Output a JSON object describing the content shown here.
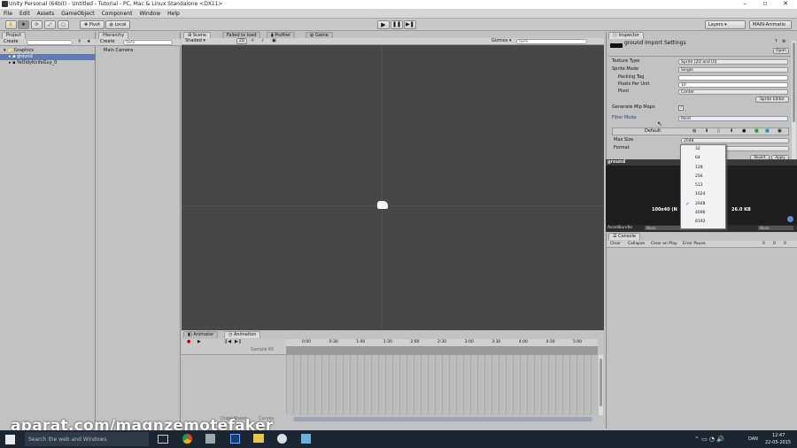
{
  "window": {
    "title": "Unity Personal (64bit) - Untitled - Tutorial - PC, Mac & Linux Standalone <DX11>"
  },
  "menu": [
    "File",
    "Edit",
    "Assets",
    "GameObject",
    "Component",
    "Window",
    "Help"
  ],
  "toolbar": {
    "pivot": "Pivot",
    "local": "Local",
    "layers": "Layers",
    "layout": "MAIN-Animatio"
  },
  "project": {
    "tab": "Project",
    "create": "Create",
    "tree": [
      {
        "label": "Graphics",
        "indent": 0
      },
      {
        "label": "ground",
        "indent": 1,
        "selected": true
      },
      {
        "label": "YeOldyKnifeGuy_0",
        "indent": 1
      }
    ]
  },
  "hierarchy": {
    "tab": "Hierarchy",
    "create": "Create",
    "search": "Q▾All",
    "items": [
      "Main Camera"
    ]
  },
  "scene": {
    "tabs": {
      "scene": "Scene",
      "failed": "Failed to load",
      "profiler": "Profiler",
      "game": "Game"
    },
    "shaded": "Shaded",
    "mode2d": "2D",
    "gizmos": "Gizmos",
    "gizmo_search": "Q▾All"
  },
  "inspector": {
    "tab": "Inspector",
    "title": "ground Import Settings",
    "open": "Open",
    "rows": [
      {
        "label": "Texture Type",
        "value": "Sprite (2D and UI)"
      },
      {
        "label": "Sprite Mode",
        "value": "Single"
      },
      {
        "label": "Packing Tag",
        "value": ""
      },
      {
        "label": "Pixels Per Unit",
        "value": "10"
      },
      {
        "label": "Pivot",
        "value": "Center"
      }
    ],
    "sprite_editor": "Sprite Editor",
    "mipmaps": "Generate Mip Maps",
    "filter_mode": {
      "label": "Filter Mode",
      "value": "Point"
    },
    "platform_default": "Default",
    "max_size": {
      "label": "Max Size",
      "value": "2048"
    },
    "format": {
      "label": "Format"
    },
    "revert": "Revert",
    "apply": "Apply"
  },
  "dropdown": {
    "options": [
      "32",
      "64",
      "128",
      "256",
      "512",
      "1024",
      "2048",
      "4096",
      "8192"
    ],
    "selected": "2048"
  },
  "preview": {
    "title": "ground",
    "info_left": "100x40 (N",
    "info_right": "26.0 KB",
    "assetbundle": "AssetBundle",
    "none1": "None",
    "none2": "None"
  },
  "console": {
    "tab": "Console",
    "buttons": [
      "Clear",
      "Collapse",
      "Clear on Play",
      "Error Pause"
    ],
    "counts": [
      "0",
      "0",
      "0"
    ]
  },
  "animation": {
    "tabs": [
      "Animator",
      "Animation"
    ],
    "sample": "Sample",
    "sample_value": "60",
    "dope": "Dope Sheet",
    "curves": "Curves",
    "times": [
      "0:00",
      "0:30",
      "1:00",
      "1:30",
      "2:00",
      "2:30",
      "3:00",
      "3:30",
      "4:00",
      "4:30",
      "5:00"
    ]
  },
  "taskbar": {
    "search": "Search the web and Windows",
    "time": "12:47",
    "date": "22-05-2015",
    "lang": "DAN"
  },
  "watermark": "aparat.com/magnzemotefaker"
}
